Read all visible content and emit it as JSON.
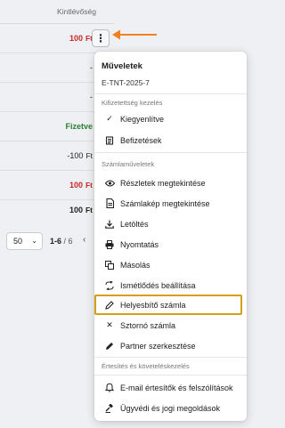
{
  "table": {
    "column_header": "Kintlévőség",
    "rows": [
      {
        "amount": "100",
        "currency": "Ft"
      },
      {
        "amount": "-"
      },
      {
        "amount": "-"
      },
      {
        "amount": "Fizetve"
      },
      {
        "amount": "-100",
        "currency": "Ft"
      },
      {
        "amount": "100",
        "currency": "Ft"
      },
      {
        "amount": "100",
        "currency": "Ft"
      }
    ]
  },
  "pagination": {
    "per_page": "50",
    "range": "1-6",
    "total": "/ 6",
    "prev": "‹"
  },
  "menu": {
    "title": "Műveletek",
    "subtitle": "E-TNT-2025-7",
    "sections": {
      "debt": "Kifizetettség kezelés",
      "invoice": "Számlaműveletek",
      "notify": "Értesítés és követeléskezelés"
    },
    "items": {
      "settled": "Kiegyenlítve",
      "payments": "Befizetések",
      "details": "Részletek megtekintése",
      "preview": "Számlakép megtekintése",
      "download": "Letöltés",
      "print": "Nyomtatás",
      "copy": "Másolás",
      "recurrence": "Ismétlődés beállítása",
      "correcting": "Helyesbítő számla",
      "storno": "Sztornó számla",
      "partner": "Partner szerkesztése",
      "email": "E-mail értesítők és felszólítások",
      "legal": "Ügyvédi és jogi megoldások"
    }
  },
  "colors": {
    "accent_arrow": "#f08020",
    "highlight_border": "#d4a017",
    "amount_red": "#c62828",
    "paid_green": "#2e7d32"
  }
}
